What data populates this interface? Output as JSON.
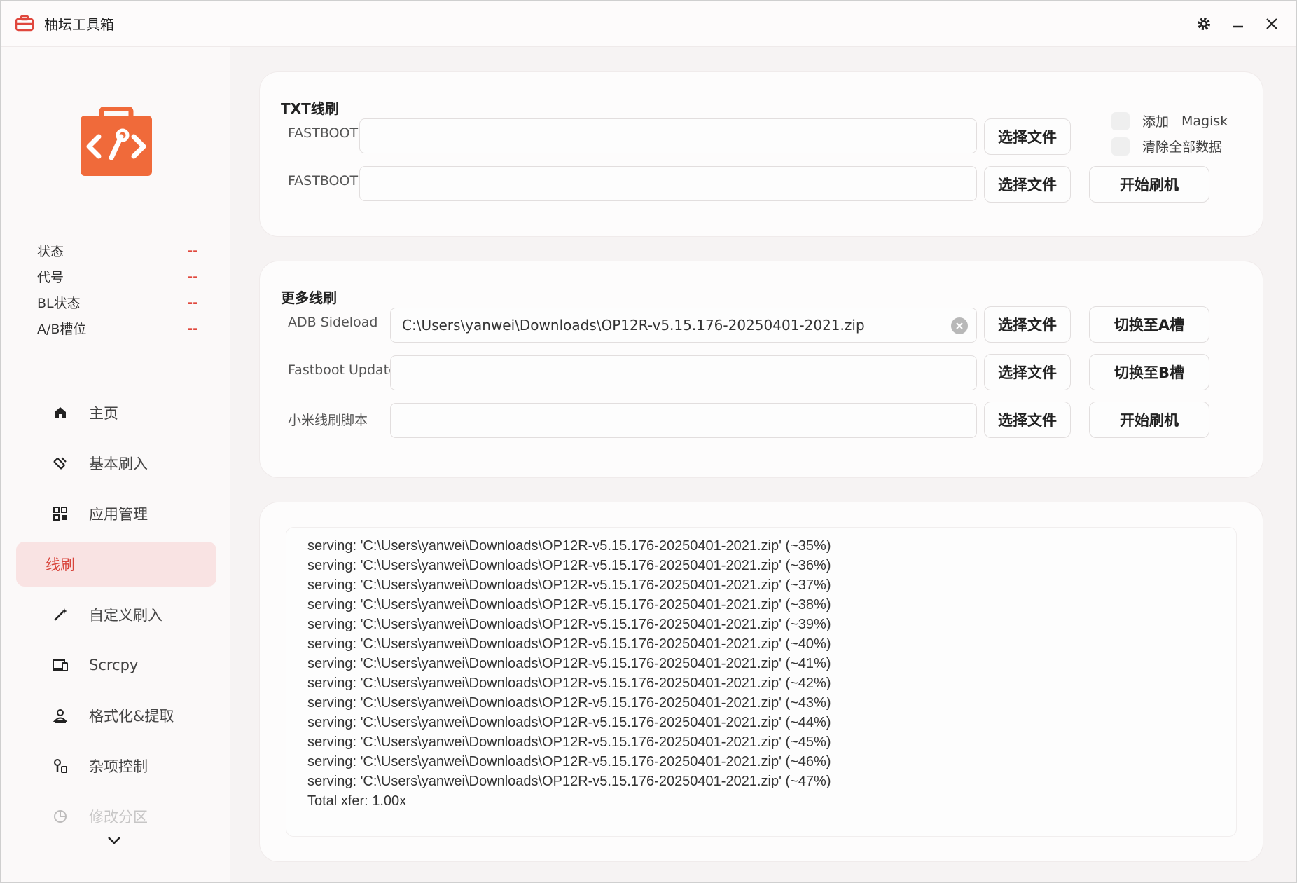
{
  "app": {
    "title": "柚坛工具箱"
  },
  "colors": {
    "accent": "#e0473d",
    "logo_orange": "#f06a3a",
    "active_bg": "#f9e3e3"
  },
  "device_info": [
    {
      "label": "状态",
      "value": "--"
    },
    {
      "label": "代号",
      "value": "--"
    },
    {
      "label": "BL状态",
      "value": "--"
    },
    {
      "label": "A/B槽位",
      "value": "--"
    }
  ],
  "nav": [
    {
      "label": "主页",
      "icon": "home-icon"
    },
    {
      "label": "基本刷入",
      "icon": "flash-icon"
    },
    {
      "label": "应用管理",
      "icon": "apps-icon"
    },
    {
      "label": "线刷",
      "icon": "",
      "active": true
    },
    {
      "label": "自定义刷入",
      "icon": "wand-icon"
    },
    {
      "label": "Scrcpy",
      "icon": "screen-mirror-icon"
    },
    {
      "label": "格式化&提取",
      "icon": "user-extract-icon"
    },
    {
      "label": "杂项控制",
      "icon": "tools-icon"
    },
    {
      "label": "修改分区",
      "icon": "partition-icon",
      "faded": true
    }
  ],
  "txt_flash": {
    "title": "TXT线刷",
    "fastboot_label": "FASTBOOT",
    "fastbootd_label": "FASTBOOTD",
    "fastboot_value": "",
    "fastbootd_value": "",
    "select_file": "选择文件",
    "add_magisk": "添加",
    "magisk": "Magisk",
    "wipe_all": "清除全部数据",
    "start_flash": "开始刷机"
  },
  "more_flash": {
    "title": "更多线刷",
    "adb_sideload_label": "ADB Sideload",
    "adb_sideload_value": "C:\\Users\\yanwei\\Downloads\\OP12R-v5.15.176-20250401-2021.zip",
    "fastboot_updated_label": "Fastboot Updated",
    "fastboot_updated_value": "",
    "xiaomi_script_label": "小米线刷脚本",
    "xiaomi_script_value": "",
    "select_file": "选择文件",
    "switch_a": "切换至A槽",
    "switch_b": "切换至B槽",
    "start_flash": "开始刷机"
  },
  "log": [
    "serving: 'C:\\Users\\yanwei\\Downloads\\OP12R-v5.15.176-20250401-2021.zip'  (~35%)",
    "serving: 'C:\\Users\\yanwei\\Downloads\\OP12R-v5.15.176-20250401-2021.zip'  (~36%)",
    "serving: 'C:\\Users\\yanwei\\Downloads\\OP12R-v5.15.176-20250401-2021.zip'  (~37%)",
    "serving: 'C:\\Users\\yanwei\\Downloads\\OP12R-v5.15.176-20250401-2021.zip'  (~38%)",
    "serving: 'C:\\Users\\yanwei\\Downloads\\OP12R-v5.15.176-20250401-2021.zip'  (~39%)",
    "serving: 'C:\\Users\\yanwei\\Downloads\\OP12R-v5.15.176-20250401-2021.zip'  (~40%)",
    "serving: 'C:\\Users\\yanwei\\Downloads\\OP12R-v5.15.176-20250401-2021.zip'  (~41%)",
    "serving: 'C:\\Users\\yanwei\\Downloads\\OP12R-v5.15.176-20250401-2021.zip'  (~42%)",
    "serving: 'C:\\Users\\yanwei\\Downloads\\OP12R-v5.15.176-20250401-2021.zip'  (~43%)",
    "serving: 'C:\\Users\\yanwei\\Downloads\\OP12R-v5.15.176-20250401-2021.zip'  (~44%)",
    "serving: 'C:\\Users\\yanwei\\Downloads\\OP12R-v5.15.176-20250401-2021.zip'  (~45%)",
    "serving: 'C:\\Users\\yanwei\\Downloads\\OP12R-v5.15.176-20250401-2021.zip'  (~46%)",
    "serving: 'C:\\Users\\yanwei\\Downloads\\OP12R-v5.15.176-20250401-2021.zip'  (~47%)",
    "Total xfer: 1.00x"
  ]
}
